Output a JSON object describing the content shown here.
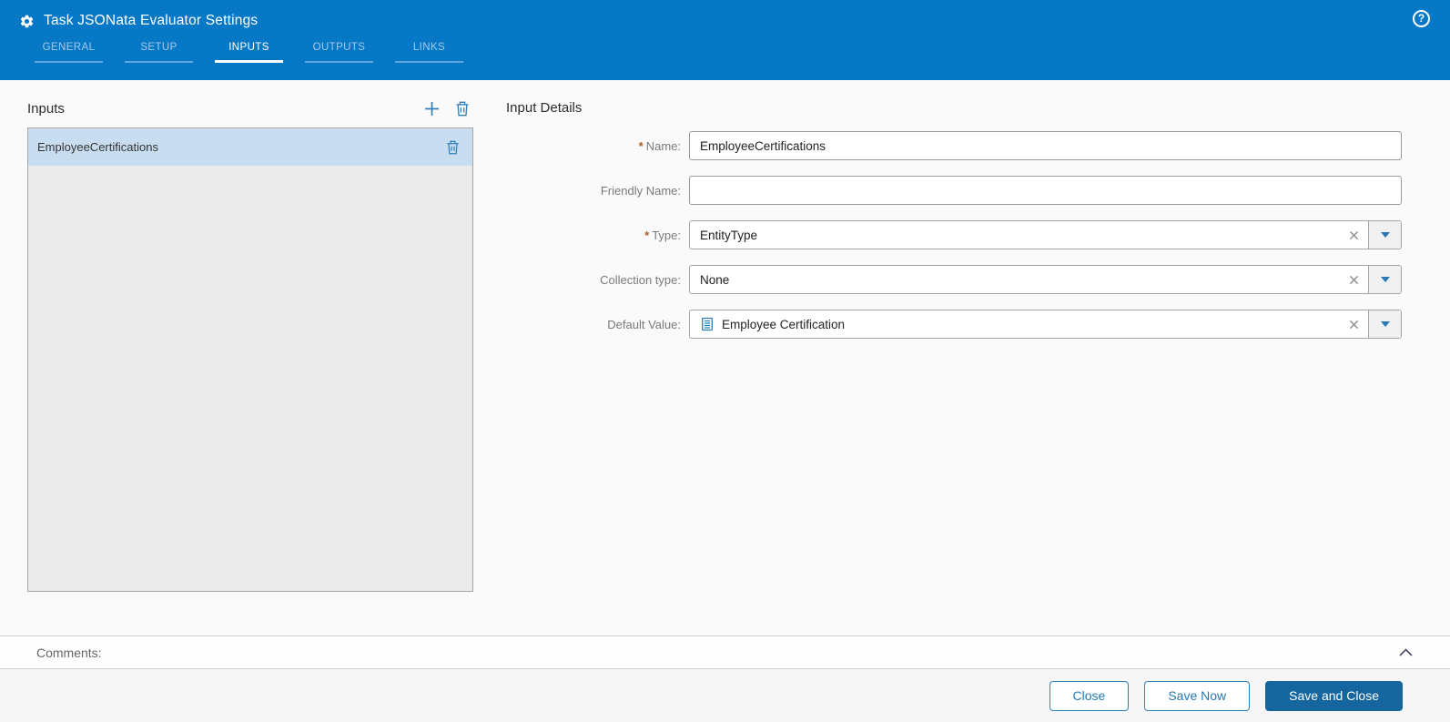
{
  "header": {
    "title": "Task JSONata Evaluator Settings",
    "help_symbol": "?",
    "tabs": [
      {
        "label": "GENERAL",
        "active": false
      },
      {
        "label": "SETUP",
        "active": false
      },
      {
        "label": "INPUTS",
        "active": true
      },
      {
        "label": "OUTPUTS",
        "active": false
      },
      {
        "label": "LINKS",
        "active": false
      }
    ]
  },
  "inputs_panel": {
    "title": "Inputs",
    "items": [
      {
        "name": "EmployeeCertifications",
        "selected": true
      }
    ]
  },
  "details": {
    "title": "Input Details",
    "required_marker": "*",
    "fields": {
      "name": {
        "label": "Name:",
        "required": true,
        "value": "EmployeeCertifications"
      },
      "friendly_name": {
        "label": "Friendly Name:",
        "required": false,
        "value": ""
      },
      "type": {
        "label": "Type:",
        "required": true,
        "value": "EntityType"
      },
      "collection_type": {
        "label": "Collection type:",
        "required": false,
        "value": "None"
      },
      "default_value": {
        "label": "Default Value:",
        "required": false,
        "value": "Employee Certification",
        "icon": "entity-document-icon"
      }
    }
  },
  "comments": {
    "label": "Comments:"
  },
  "footer": {
    "buttons": [
      {
        "label": "Close",
        "variant": "outline"
      },
      {
        "label": "Save Now",
        "variant": "outline"
      },
      {
        "label": "Save and Close",
        "variant": "primary"
      }
    ]
  },
  "colors": {
    "header_blue": "#0778c6",
    "accent_blue": "#2e7fb9",
    "primary_button_blue": "#15669f",
    "selected_row_blue": "#c8def0",
    "list_panel_gray": "#ebebeb",
    "required_marker_orange": "#b05a1e",
    "inactive_tab_blue": "#a5c9e8"
  }
}
